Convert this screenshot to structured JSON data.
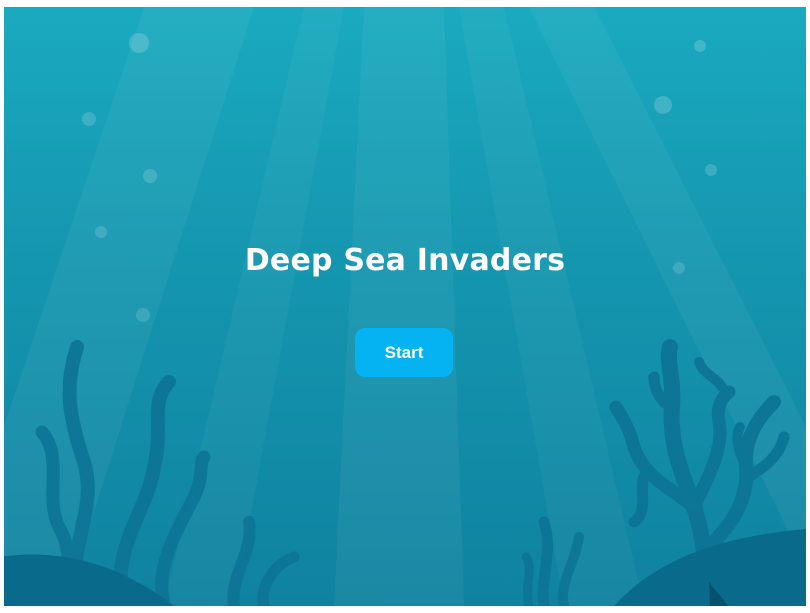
{
  "game": {
    "title": "Deep Sea Invaders",
    "start_label": "Start"
  },
  "colors": {
    "water_top": "#1aaabf",
    "water_bottom": "#0f82a0",
    "button": "#05b2f2",
    "seaweed": "#0d7495",
    "seabed": "#0a6a8c",
    "text": "#ffffff"
  }
}
